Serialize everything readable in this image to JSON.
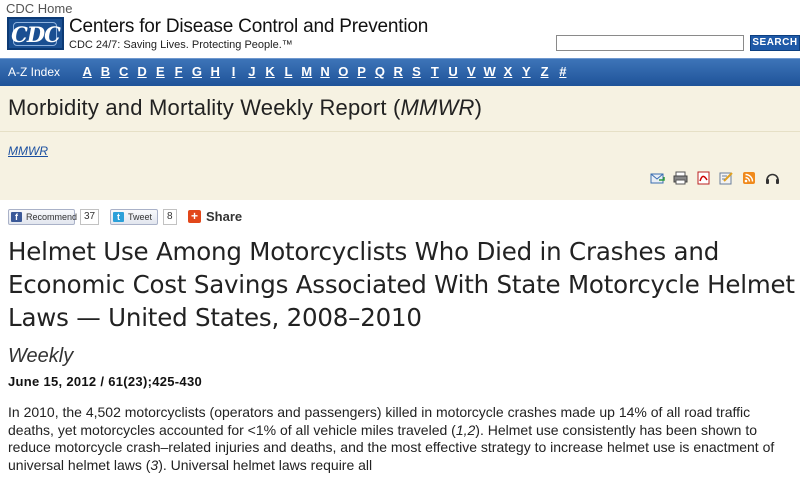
{
  "header": {
    "cdc_home": "CDC Home",
    "logo_text": "CDC",
    "org_name": "Centers for Disease Control and Prevention",
    "tagline": "CDC 24/7: Saving Lives. Protecting People.™",
    "search_placeholder": "",
    "search_button": "SEARCH"
  },
  "az_nav": {
    "label": "A-Z Index",
    "letters": [
      "A",
      "B",
      "C",
      "D",
      "E",
      "F",
      "G",
      "H",
      "I",
      "J",
      "K",
      "L",
      "M",
      "N",
      "O",
      "P",
      "Q",
      "R",
      "S",
      "T",
      "U",
      "V",
      "W",
      "X",
      "Y",
      "Z",
      "#"
    ]
  },
  "mmwr": {
    "title_prefix": "Morbidity and Mortality Weekly Report (",
    "title_italic": "MMWR",
    "title_suffix": ")",
    "breadcrumb": "MMWR"
  },
  "tools": [
    "email-icon",
    "print-icon",
    "pdf-icon",
    "edit-icon",
    "rss-icon",
    "podcast-icon"
  ],
  "social": {
    "facebook_label": "Recommend",
    "facebook_count": "37",
    "twitter_label": "Tweet",
    "twitter_count": "8",
    "share_label": "Share"
  },
  "article": {
    "title": "Helmet Use Among Motorcyclists Who Died in Crashes and Economic Cost Savings Associated With State Motorcycle Helmet Laws — United States, 2008–2010",
    "series": "Weekly",
    "date": "June 15, 2012 / 61(23);425-430",
    "body_1": "In 2010, the 4,502 motorcyclists (operators and passengers) killed in motorcycle crashes made up 14% of all road traffic deaths, yet motorcycles accounted for <1% of all vehicle miles traveled (",
    "ref_1": "1,2",
    "body_2": "). Helmet use consistently has been shown to reduce motorcycle crash–related injuries and deaths, and the most effective strategy to increase helmet use is enactment of universal helmet laws (",
    "ref_2": "3",
    "body_3": "). Universal helmet laws require all"
  },
  "colors": {
    "nav_blue": "#1f5399",
    "band_beige": "#f6f2e2",
    "link_blue": "#1a4fa0"
  }
}
